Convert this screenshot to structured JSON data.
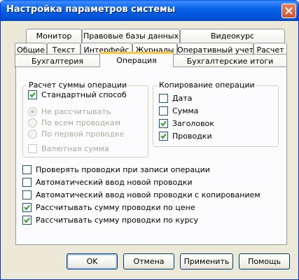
{
  "window": {
    "title": "Настройка параметров системы"
  },
  "tabs": {
    "row_top": [
      "Монитор",
      "Правовые базы данных",
      "Видеокурс"
    ],
    "row_middle": [
      "Общие",
      "Текст",
      "Интерфейс",
      "Журналы",
      "Оперативный учет",
      "Расчет"
    ],
    "row_bottom": [
      "Бухгалтерия",
      "Операция",
      "Бухгалтерские итоги"
    ],
    "active": "Операция"
  },
  "calc_group": {
    "title": "Расчет суммы операции",
    "standard": {
      "label": "Стандартный способ",
      "checked": true
    },
    "radios": [
      {
        "label": "Не рассчитывать",
        "selected": true
      },
      {
        "label": "По всем проводкам",
        "selected": false
      },
      {
        "label": "По первой проводке",
        "selected": false
      }
    ],
    "currency": {
      "label": "Валютная сумма",
      "checked": false
    }
  },
  "copy_group": {
    "title": "Копирование операции",
    "items": [
      {
        "label": "Дата",
        "checked": false
      },
      {
        "label": "Сумма",
        "checked": false
      },
      {
        "label": "Заголовок",
        "checked": true
      },
      {
        "label": "Проводки",
        "checked": true
      }
    ]
  },
  "options": [
    {
      "label": "Проверять проводки при записи операции",
      "checked": false
    },
    {
      "label": "Автоматический ввод новой проводки",
      "checked": false
    },
    {
      "label": "Автоматический ввод новой проводки с копированием",
      "checked": false
    },
    {
      "label": "Рассчитывать сумму проводки по цене",
      "checked": true
    },
    {
      "label": "Рассчитывать сумму проводки по курсу",
      "checked": true
    }
  ],
  "buttons": {
    "ok": "OK",
    "cancel": "Отмена",
    "apply": "Применить",
    "help": "Помощь"
  }
}
